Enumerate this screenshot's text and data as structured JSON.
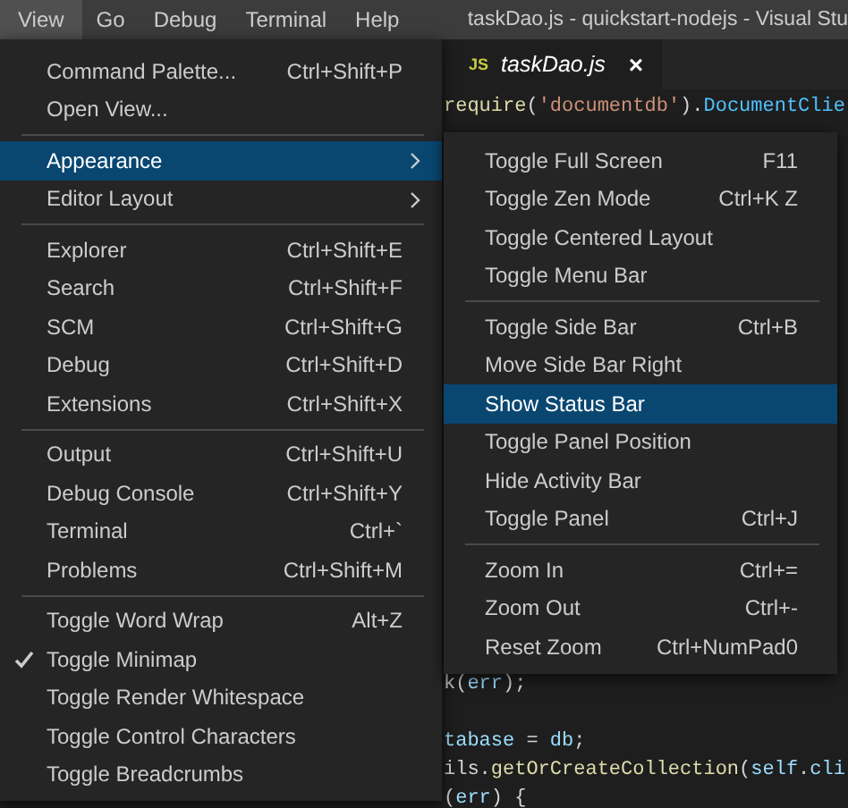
{
  "menubar": {
    "items": [
      {
        "label": "View",
        "selected": true
      },
      {
        "label": "Go",
        "selected": false
      },
      {
        "label": "Debug",
        "selected": false
      },
      {
        "label": "Terminal",
        "selected": false
      },
      {
        "label": "Help",
        "selected": false
      }
    ],
    "title": "taskDao.js - quickstart-nodejs - Visual Stu"
  },
  "editor": {
    "tab": {
      "icon_text": "JS",
      "label": "taskDao.js",
      "close": "×"
    },
    "top_lines": [
      [
        {
          "text": "require",
          "kind": "func"
        },
        {
          "text": "(",
          "kind": "plain"
        },
        {
          "text": "'documentdb'",
          "kind": "string"
        },
        {
          "text": ").",
          "kind": "plain"
        },
        {
          "text": "DocumentClie",
          "kind": "type"
        }
      ]
    ],
    "bottom_lines": [
      [
        {
          "text": "k(",
          "kind": "plain"
        },
        {
          "text": "err",
          "kind": "var"
        },
        {
          "text": ");",
          "kind": "plain"
        }
      ],
      [
        {
          "kind": "blank_line"
        },
        {
          "text": "tabase",
          "kind": "var"
        },
        {
          "text": " = ",
          "kind": "plain"
        },
        {
          "text": "db",
          "kind": "var"
        },
        {
          "text": ";",
          "kind": "plain"
        }
      ],
      [
        {
          "text": "ils.",
          "kind": "plain"
        },
        {
          "text": "getOrCreateCollection",
          "kind": "func"
        },
        {
          "text": "(",
          "kind": "plain"
        },
        {
          "text": "self",
          "kind": "var"
        },
        {
          "text": ".",
          "kind": "plain"
        },
        {
          "text": "cli",
          "kind": "var"
        }
      ],
      [
        {
          "text": "(",
          "kind": "plain"
        },
        {
          "text": "err",
          "kind": "var"
        },
        {
          "text": ") {",
          "kind": "plain"
        }
      ]
    ]
  },
  "view_menu": [
    {
      "kind": "item",
      "label": "Command Palette...",
      "shortcut": "Ctrl+Shift+P",
      "checked": false,
      "selected": false
    },
    {
      "kind": "item",
      "label": "Open View...",
      "checked": false,
      "selected": false
    },
    {
      "kind": "separator"
    },
    {
      "kind": "submenu",
      "label": "Appearance",
      "checked": false,
      "selected": true
    },
    {
      "kind": "submenu",
      "label": "Editor Layout",
      "checked": false,
      "selected": false
    },
    {
      "kind": "separator"
    },
    {
      "kind": "item",
      "label": "Explorer",
      "shortcut": "Ctrl+Shift+E",
      "checked": false,
      "selected": false
    },
    {
      "kind": "item",
      "label": "Search",
      "shortcut": "Ctrl+Shift+F",
      "checked": false,
      "selected": false
    },
    {
      "kind": "item",
      "label": "SCM",
      "shortcut": "Ctrl+Shift+G",
      "checked": false,
      "selected": false
    },
    {
      "kind": "item",
      "label": "Debug",
      "shortcut": "Ctrl+Shift+D",
      "checked": false,
      "selected": false
    },
    {
      "kind": "item",
      "label": "Extensions",
      "shortcut": "Ctrl+Shift+X",
      "checked": false,
      "selected": false
    },
    {
      "kind": "separator"
    },
    {
      "kind": "item",
      "label": "Output",
      "shortcut": "Ctrl+Shift+U",
      "checked": false,
      "selected": false
    },
    {
      "kind": "item",
      "label": "Debug Console",
      "shortcut": "Ctrl+Shift+Y",
      "checked": false,
      "selected": false
    },
    {
      "kind": "item",
      "label": "Terminal",
      "shortcut": "Ctrl+`",
      "checked": false,
      "selected": false
    },
    {
      "kind": "item",
      "label": "Problems",
      "shortcut": "Ctrl+Shift+M",
      "checked": false,
      "selected": false
    },
    {
      "kind": "separator"
    },
    {
      "kind": "item",
      "label": "Toggle Word Wrap",
      "shortcut": "Alt+Z",
      "checked": false,
      "selected": false
    },
    {
      "kind": "item",
      "label": "Toggle Minimap",
      "checked": true,
      "selected": false
    },
    {
      "kind": "item",
      "label": "Toggle Render Whitespace",
      "checked": false,
      "selected": false
    },
    {
      "kind": "item",
      "label": "Toggle Control Characters",
      "checked": false,
      "selected": false
    },
    {
      "kind": "item",
      "label": "Toggle Breadcrumbs",
      "checked": false,
      "selected": false
    }
  ],
  "appearance_menu": [
    {
      "kind": "item",
      "label": "Toggle Full Screen",
      "shortcut": "F11",
      "selected": false
    },
    {
      "kind": "item",
      "label": "Toggle Zen Mode",
      "shortcut": "Ctrl+K Z",
      "selected": false
    },
    {
      "kind": "item",
      "label": "Toggle Centered Layout",
      "selected": false
    },
    {
      "kind": "item",
      "label": "Toggle Menu Bar",
      "selected": false
    },
    {
      "kind": "separator"
    },
    {
      "kind": "item",
      "label": "Toggle Side Bar",
      "shortcut": "Ctrl+B",
      "selected": false
    },
    {
      "kind": "item",
      "label": "Move Side Bar Right",
      "selected": false
    },
    {
      "kind": "item",
      "label": "Show Status Bar",
      "selected": true
    },
    {
      "kind": "item",
      "label": "Toggle Panel Position",
      "selected": false
    },
    {
      "kind": "item",
      "label": "Hide Activity Bar",
      "selected": false
    },
    {
      "kind": "item",
      "label": "Toggle Panel",
      "shortcut": "Ctrl+J",
      "selected": false
    },
    {
      "kind": "separator"
    },
    {
      "kind": "item",
      "label": "Zoom In",
      "shortcut": "Ctrl+=",
      "selected": false
    },
    {
      "kind": "item",
      "label": "Zoom Out",
      "shortcut": "Ctrl+-",
      "selected": false
    },
    {
      "kind": "item",
      "label": "Reset Zoom",
      "shortcut": "Ctrl+NumPad0",
      "selected": false
    }
  ]
}
